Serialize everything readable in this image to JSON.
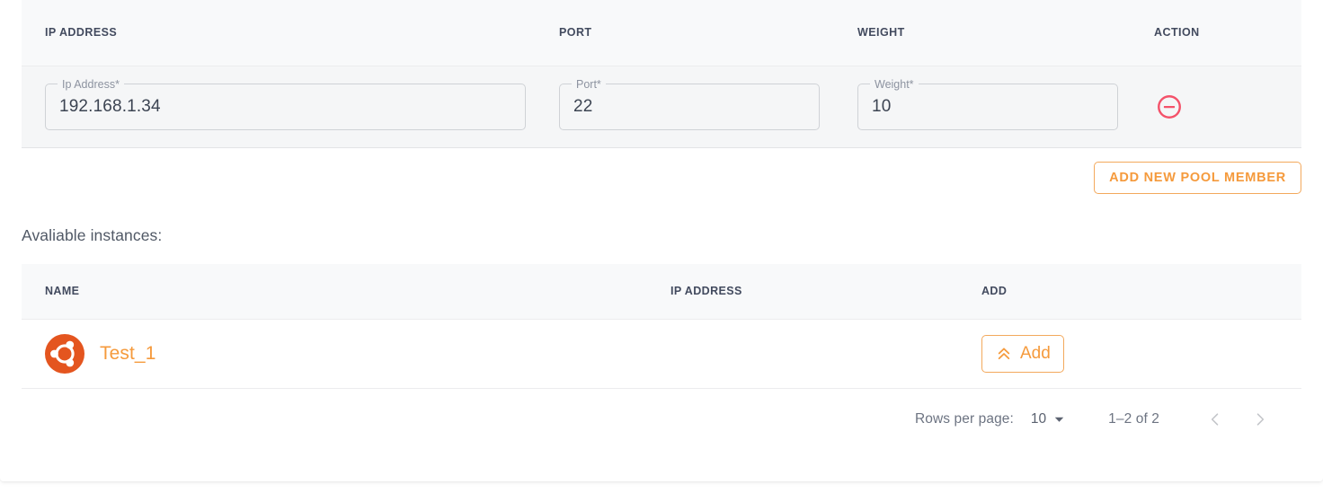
{
  "colors": {
    "accent_orange": "#f59a3c",
    "accent_orange_border": "#f3a95c",
    "remove_red": "#f4526a",
    "ubuntu_orange": "#e4551f",
    "header_text": "#424a5e",
    "header_bg": "#f8f9fa",
    "form_row_bg": "#f5f6f7"
  },
  "pool_table": {
    "headers": [
      "IP ADDRESS",
      "PORT",
      "WEIGHT",
      "ACTION"
    ],
    "row": {
      "ip_address": {
        "label": "Ip Address*",
        "value": "192.168.1.34",
        "placeholder": ""
      },
      "port": {
        "label": "Port*",
        "value": "22",
        "placeholder": ""
      },
      "weight": {
        "label": "Weight*",
        "value": "10",
        "placeholder": ""
      },
      "action_icon": "remove-circle-icon"
    }
  },
  "add_member": {
    "label": "ADD NEW POOL MEMBER"
  },
  "available_section": {
    "title": "Avaliable instances:"
  },
  "instances_table": {
    "headers": [
      "NAME",
      "IP ADDRESS",
      "ADD"
    ],
    "rows": [
      {
        "icon": "ubuntu-logo-icon",
        "name": "Test_1",
        "ip_address": "",
        "add_label": "Add",
        "add_icon": "double-chevron-up-icon"
      }
    ]
  },
  "paginator": {
    "rows_per_page_label": "Rows per page:",
    "rows_per_page_value": "10",
    "dropdown_icon": "chevron-down-icon",
    "range_label": "1–2 of 2",
    "prev_icon": "chevron-left-icon",
    "next_icon": "chevron-right-icon"
  }
}
